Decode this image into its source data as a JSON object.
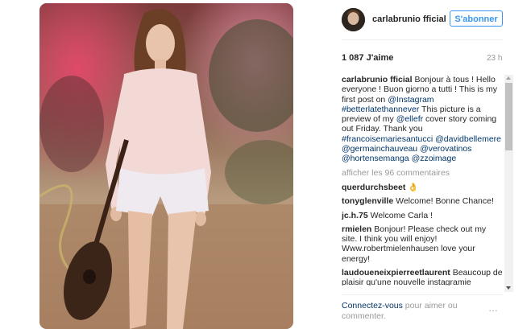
{
  "post": {
    "image_alt": "Woman in pink shirt and white shorts holding a guitar in a garden"
  },
  "header": {
    "username": "carlabrunio fficial",
    "follow_label": "S'abonner"
  },
  "stats": {
    "likes": "1 087 J'aime",
    "time": "23 h"
  },
  "caption": {
    "username": "carlabrunio fficial",
    "text_1": "Bonjour à tous ! Hello everyone ! Buon giorno a tutti ! This is my first post on ",
    "mention_1": "@Instagram",
    "text_2": " ",
    "hashtag_1": "#betterlatethannever",
    "text_3": " This picture is a preview of my ",
    "mention_2": "@ellefr",
    "text_4": " cover story coming out Friday. Thank you ",
    "hashtag_2": "#francoisemariesantucci",
    "mention_3": "@davidbellemere",
    "mention_4": "@germainchauveau",
    "mention_5": "@verovatinos",
    "mention_6": "@hortensemanga",
    "mention_7": "@zzoimage"
  },
  "view_more": "afficher les 96 commentaires",
  "comments": [
    {
      "user": "querdurchsbeet",
      "text": "👌"
    },
    {
      "user": "tonyglenville",
      "text": "Welcome! Bonne Chance!"
    },
    {
      "user": "jc.h.75",
      "text": "Welcome Carla !"
    },
    {
      "user": "rmielen",
      "text": "Bonjour! Please check out my site. I think you will enjoy! Www.robertmielenhausen love your energy!"
    },
    {
      "user": "laudoueneixpierreetlaurent",
      "text": "Beaucoup de plaisir qu'une nouvelle instagramie"
    }
  ],
  "footer": {
    "login_link": "Connectez-vous",
    "login_text": " pour aimer ou commenter.",
    "more_label": "…"
  }
}
